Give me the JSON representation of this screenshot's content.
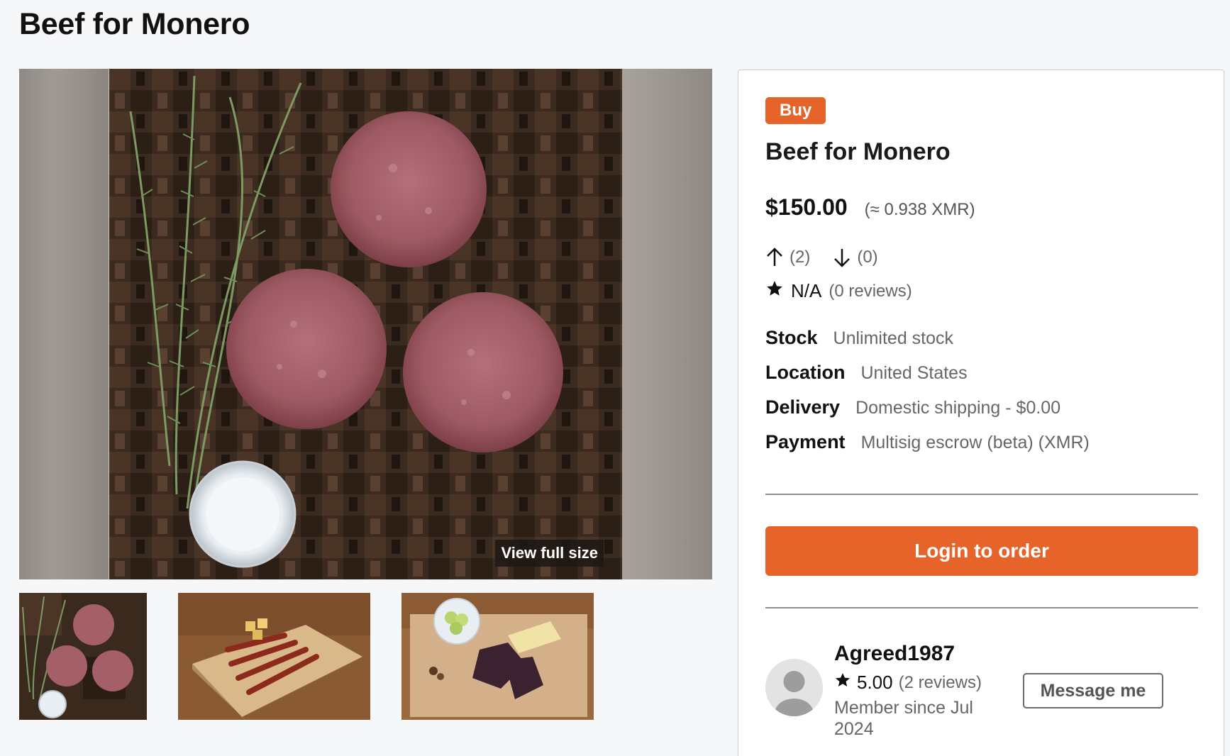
{
  "page": {
    "title": "Beef for Monero"
  },
  "gallery": {
    "view_full_label": "View full size"
  },
  "listing": {
    "badge": "Buy",
    "title": "Beef for Monero",
    "price": "$150.00",
    "price_xmr": "(≈ 0.938 XMR)",
    "upvotes": "(2)",
    "downvotes": "(0)",
    "rating": "N/A",
    "reviews": "(0 reviews)",
    "specs": [
      {
        "key": "Stock",
        "value": "Unlimited stock"
      },
      {
        "key": "Location",
        "value": "United States"
      },
      {
        "key": "Delivery",
        "value": "Domestic shipping - $0.00"
      },
      {
        "key": "Payment",
        "value": "Multisig escrow (beta) (XMR)"
      }
    ],
    "order_button": "Login to order"
  },
  "seller": {
    "name": "Agreed1987",
    "rating": "5.00",
    "reviews": "(2 reviews)",
    "member_since": "Member since Jul 2024",
    "message_button": "Message me"
  },
  "colors": {
    "accent": "#e6632a"
  },
  "icons": [
    "arrow-up-icon",
    "arrow-down-icon",
    "star-icon",
    "avatar-placeholder-icon"
  ]
}
